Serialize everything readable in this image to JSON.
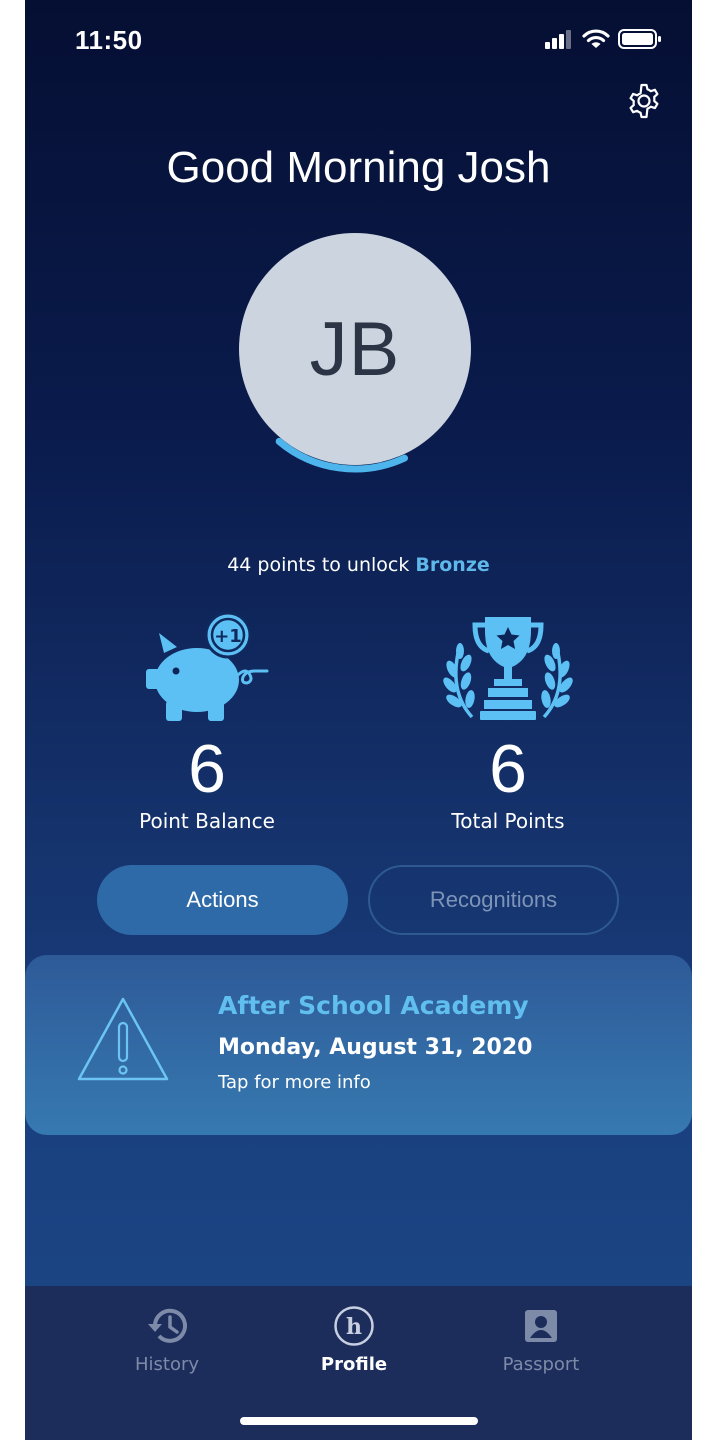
{
  "status_bar": {
    "time": "11:50"
  },
  "header": {
    "greeting": "Good Morning Josh",
    "settings_icon": "gear-icon"
  },
  "profile": {
    "initials": "JB",
    "progress": 0.18
  },
  "progress": {
    "prefix": "44 points to unlock ",
    "tier": "Bronze"
  },
  "stats": [
    {
      "icon": "piggy-bank-icon",
      "badge": "+1",
      "value": "6",
      "label": "Point Balance"
    },
    {
      "icon": "trophy-icon",
      "value": "6",
      "label": "Total Points"
    }
  ],
  "segments": {
    "active": "Actions",
    "inactive": "Recognitions"
  },
  "event": {
    "icon": "warning-icon",
    "title": "After School Academy",
    "date": "Monday, August 31, 2020",
    "info": "Tap for more info"
  },
  "tabs": [
    {
      "icon": "history-icon",
      "label": "History"
    },
    {
      "icon": "profile-h-icon",
      "label": "Profile"
    },
    {
      "icon": "passport-icon",
      "label": "Passport"
    }
  ],
  "colors": {
    "accent": "#5fb8ea",
    "button_active": "#2f6aa8",
    "card": "#3679b0",
    "tabbar": "#1c2d5c"
  }
}
